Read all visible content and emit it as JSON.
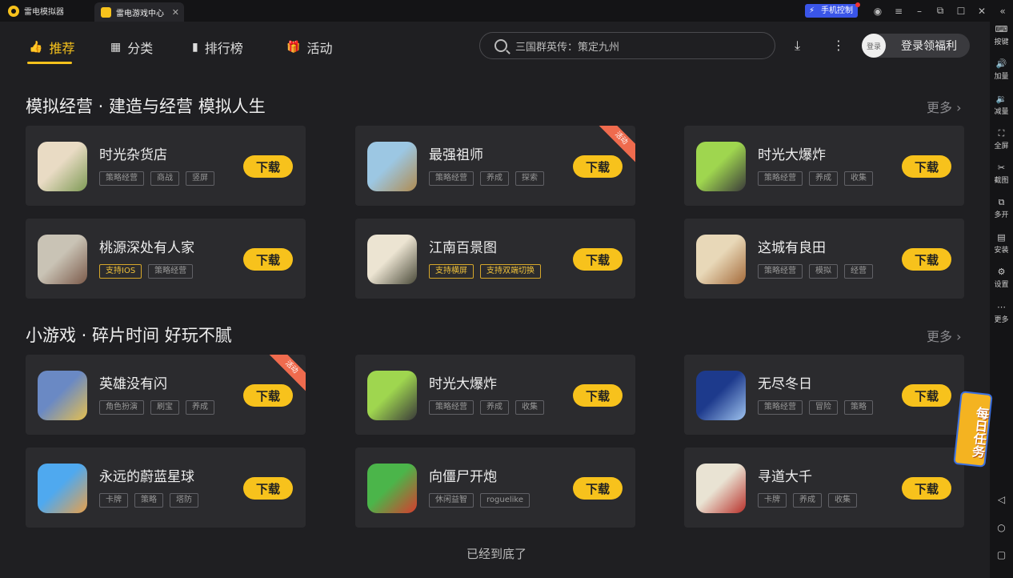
{
  "titlebar": {
    "tabs": [
      {
        "label": "雷电模拟器"
      },
      {
        "label": "雷电游戏中心",
        "close": "✕"
      }
    ],
    "phone_control": "手机控制"
  },
  "nav": {
    "items": [
      {
        "label": "推荐",
        "icon": "thumbs-up-icon",
        "glyph": "👍"
      },
      {
        "label": "分类",
        "icon": "grid-icon",
        "glyph": "▦"
      },
      {
        "label": "排行榜",
        "icon": "bar-chart-icon",
        "glyph": "▮"
      },
      {
        "label": "活动",
        "icon": "gift-icon",
        "glyph": "🎁"
      }
    ],
    "search_placeholder": "三国群英传：策定九州",
    "login_avatar": "登录",
    "login_label": "登录领福利"
  },
  "sections": [
    {
      "title": "模拟经营 · 建造与经营 模拟人生",
      "more": "更多",
      "games": [
        {
          "name": "时光杂货店",
          "tags": [
            "策略经营",
            "商战",
            "竖屏"
          ],
          "button": "下载",
          "colors": [
            "#e9dbc4",
            "#7e9a55"
          ]
        },
        {
          "name": "最强祖师",
          "tags": [
            "策略经营",
            "养成",
            "探索"
          ],
          "button": "下载",
          "ribbon": "活动",
          "colors": [
            "#9cc7e3",
            "#b08b50"
          ]
        },
        {
          "name": "时光大爆炸",
          "tags": [
            "策略经营",
            "养成",
            "收集"
          ],
          "button": "下载",
          "colors": [
            "#9fd64f",
            "#3a3a3a"
          ]
        },
        {
          "name": "桃源深处有人家",
          "tags": [
            "支持IOS",
            "策略经营"
          ],
          "gold_tags": [
            0
          ],
          "button": "下载",
          "colors": [
            "#c9c3b5",
            "#7b5a4a"
          ]
        },
        {
          "name": "江南百景图",
          "tags": [
            "支持横屏",
            "支持双端切换"
          ],
          "gold_tags": [
            0,
            1
          ],
          "button": "下载",
          "colors": [
            "#ece4d2",
            "#4b4b3a"
          ]
        },
        {
          "name": "这城有良田",
          "tags": [
            "策略经营",
            "模拟",
            "经营"
          ],
          "button": "下载",
          "colors": [
            "#e8d8b8",
            "#a46a3a"
          ]
        }
      ]
    },
    {
      "title": "小游戏 · 碎片时间 好玩不腻",
      "more": "更多",
      "games": [
        {
          "name": "英雄没有闪",
          "tags": [
            "角色扮演",
            "刷宝",
            "养成"
          ],
          "button": "下载",
          "ribbon": "活动",
          "colors": [
            "#6a89c4",
            "#e6c04f"
          ]
        },
        {
          "name": "时光大爆炸",
          "tags": [
            "策略经营",
            "养成",
            "收集"
          ],
          "button": "下载",
          "colors": [
            "#9fd64f",
            "#3a3a3a"
          ]
        },
        {
          "name": "无尽冬日",
          "tags": [
            "策略经营",
            "冒险",
            "策略"
          ],
          "button": "下载",
          "colors": [
            "#1d3a8c",
            "#9fc3ef"
          ]
        },
        {
          "name": "永远的蔚蓝星球",
          "tags": [
            "卡牌",
            "策略",
            "塔防"
          ],
          "button": "下载",
          "colors": [
            "#4fa9ef",
            "#e8a04a"
          ]
        },
        {
          "name": "向僵尸开炮",
          "tags": [
            "休闲益智",
            "roguelike"
          ],
          "button": "下载",
          "colors": [
            "#4bb54a",
            "#d83c2e"
          ]
        },
        {
          "name": "寻道大千",
          "tags": [
            "卡牌",
            "养成",
            "收集"
          ],
          "button": "下载",
          "colors": [
            "#e9e3d3",
            "#b8302a"
          ]
        }
      ]
    }
  ],
  "bottom_text": "已经到底了",
  "sidebar": [
    {
      "label": "按键",
      "icon": "keyboard-icon",
      "glyph": "⌨"
    },
    {
      "label": "加量",
      "icon": "volume-up-icon",
      "glyph": "🔊"
    },
    {
      "label": "减量",
      "icon": "volume-down-icon",
      "glyph": "🔉"
    },
    {
      "label": "全屏",
      "icon": "fullscreen-icon",
      "glyph": "⛶"
    },
    {
      "label": "截图",
      "icon": "scissors-icon",
      "glyph": "✂"
    },
    {
      "label": "多开",
      "icon": "multi-instance-icon",
      "glyph": "⧉"
    },
    {
      "label": "安装",
      "icon": "install-icon",
      "glyph": "▤"
    },
    {
      "label": "设置",
      "icon": "gear-icon",
      "glyph": "⚙"
    },
    {
      "label": "更多",
      "icon": "more-icon",
      "glyph": "⋯"
    }
  ],
  "daily_task": "每日任务"
}
